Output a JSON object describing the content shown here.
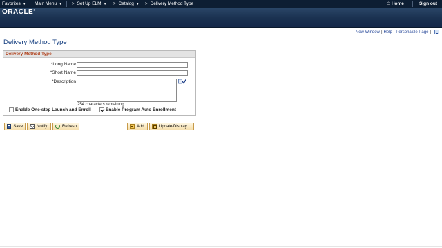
{
  "nav": {
    "favorites": "Favorites",
    "main_menu": "Main Menu",
    "crumbs": [
      "Set Up ELM",
      "Catalog",
      "Delivery Method Type"
    ],
    "home": "Home",
    "sign_out": "Sign out"
  },
  "header": {
    "logo": "ORACLE"
  },
  "util_links": {
    "new_window": "New Window",
    "help": "Help",
    "personalize": "Personalize Page"
  },
  "page": {
    "title": "Delivery Method Type"
  },
  "group": {
    "title": "Delivery Method Type",
    "long_name": {
      "label": "*Long Name",
      "value": ""
    },
    "short_name": {
      "label": "*Short Name",
      "value": ""
    },
    "description": {
      "label": "*Description",
      "value": ""
    },
    "remaining": "254 characters remaining",
    "one_step": {
      "label": "Enable One-step Launch and Enroll",
      "checked": false
    },
    "auto_enroll": {
      "label": "Enable Program Auto Enrollment",
      "checked": true
    }
  },
  "buttons": {
    "save": "Save",
    "notify": "Notify",
    "refresh": "Refresh",
    "add": "Add",
    "update": "Update/Display"
  },
  "icons": [
    "home-icon",
    "spell-check-icon",
    "save-icon",
    "notify-icon",
    "refresh-icon",
    "add-icon",
    "update-display-icon",
    "personalize-grid-icon"
  ],
  "colors": {
    "nav_bg": "#0d1e33",
    "header_bg": "#1a3150",
    "title_blue": "#0f3a7d",
    "group_title": "#b0411c",
    "button_bg": "#f6dfae"
  }
}
